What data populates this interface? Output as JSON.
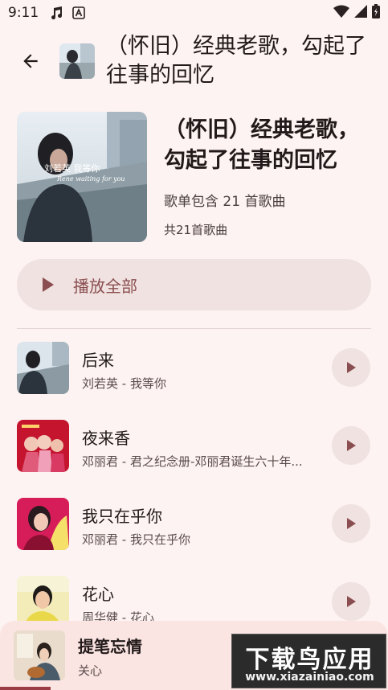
{
  "status_bar": {
    "time": "9:11",
    "icons": [
      "music-note-icon",
      "font-a-icon"
    ],
    "right_icons": [
      "wifi-icon",
      "signal-icon",
      "battery-icon"
    ]
  },
  "header": {
    "title": "（怀旧）经典老歌，勾起了往事的回忆",
    "back_icon": "arrow-left-icon"
  },
  "playlist": {
    "title": "（怀旧）经典老歌，勾起了往事的回忆",
    "description": "歌单包含 21 首歌曲",
    "count_text": "共21首歌曲",
    "cover_caption": "刘若英 我等你",
    "cover_caption_en": "Rene waiting for you"
  },
  "play_all": {
    "label": "播放全部",
    "icon": "play-icon"
  },
  "songs": [
    {
      "title": "后来",
      "subtitle": "刘若英 - 我等你"
    },
    {
      "title": "夜来香",
      "subtitle": "邓丽君 - 君之纪念册-邓丽君诞生六十年..."
    },
    {
      "title": "我只在乎你",
      "subtitle": "邓丽君 - 我只在乎你"
    },
    {
      "title": "花心",
      "subtitle": "周华健 - 花心"
    }
  ],
  "mini_player": {
    "title": "提笔忘情",
    "artist": "关心",
    "progress": 0.13
  },
  "watermark": {
    "main": "下载鸟应用",
    "sub": "www.xiazainiao.com"
  },
  "colors": {
    "background": "#fdf3f2",
    "accent": "#8a4e50",
    "button_bg": "#f0e2e0",
    "mini_player_bg": "#fbe5e3",
    "progress": "#9b3b44"
  }
}
